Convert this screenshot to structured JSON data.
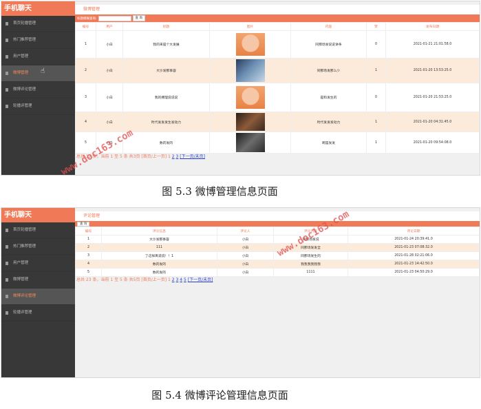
{
  "sidebar": {
    "brand": "手机聊天",
    "items": [
      {
        "label": "首页轮播管理"
      },
      {
        "label": "热门推荐管理"
      },
      {
        "label": "用户管理"
      },
      {
        "label": "微博管理"
      },
      {
        "label": "微博评论管理"
      },
      {
        "label": "轮播评管理"
      }
    ]
  },
  "screen1": {
    "title": "微博管理",
    "search_label": "标题模糊查询:",
    "search_value": "",
    "search_button": "查 询",
    "columns": [
      "编号",
      "用户",
      "标题",
      "图片",
      "内容",
      "赞",
      "发布日期"
    ],
    "rows": [
      {
        "id": "1",
        "user": "小白",
        "title": "我的来是个大发展",
        "image": "cartoon-girl",
        "content": "同那场发说说讲条",
        "likes": "0",
        "date": "2021-01-21 21:01:58.0"
      },
      {
        "id": "2",
        "user": "小白",
        "title": "大沙发那事容",
        "image": "couple-photo",
        "content": "同那场发那么少",
        "likes": "1",
        "date": "2021-01-20 13:53:25.0"
      },
      {
        "id": "3",
        "user": "小白",
        "title": "我的拥理说说说",
        "image": "cartoon-girl",
        "content": "是和发生的",
        "likes": "0",
        "date": "2021-01-20 21:53:25.0"
      },
      {
        "id": "4",
        "user": "小白",
        "title": "时代发发发生发动力",
        "image": "dark-portrait",
        "content": "时代发发发动力",
        "likes": "1",
        "date": "2021-01-20 04:31:45.0"
      },
      {
        "id": "5",
        "user": "小白",
        "title": "数的发的",
        "image": "dark-scene",
        "content": "啊是发发",
        "likes": "1",
        "date": "2021-01-20 09:54:08.0"
      }
    ],
    "pager": {
      "summary": "总共 12 条，当前 1 至 5 条 共3页",
      "first_prev": "[首页/上一页]",
      "pages": [
        "1",
        "2",
        "3"
      ],
      "next_last": "[下一页/末页]"
    }
  },
  "caption1": "图 5.3 微博管理信息页面",
  "screen2": {
    "title": "评论管理",
    "search_button": "查 询",
    "columns": [
      "编号",
      "评论信息",
      "评论人",
      "评论内容",
      "评论日期"
    ],
    "rows": [
      {
        "id": "1",
        "target": "大沙发那事容",
        "user": "小白",
        "content": "同那场发说",
        "date": "2021-01-24 20:39:41.0"
      },
      {
        "id": "2",
        "target": "111",
        "user": "小白",
        "content": "同那场发发全",
        "date": "2021-01-23 07:08:32.0"
      },
      {
        "id": "3",
        "target": "了这样离说说！！1",
        "user": "小白",
        "content": "同那场发生的",
        "date": "2021-01-28 02:21:06.0"
      },
      {
        "id": "4",
        "target": "数的发的",
        "user": "小白",
        "content": "我我我我我我",
        "date": "2021-01-23 14:42:50.0"
      },
      {
        "id": "5",
        "target": "数的发的",
        "user": "小白",
        "content": "1111",
        "date": "2021-01-23 04:50:29.0"
      }
    ],
    "pager": {
      "summary": "总共 23 条，当前 1 至 5 条 共5页",
      "first_prev": "[首页/上一页]",
      "pages": [
        "1",
        "2",
        "3",
        "4",
        "5"
      ],
      "next_last": "[下一页/末页]"
    }
  },
  "caption2": "图 5.4 微博评论管理信息页面",
  "watermark": "www.doc163.com",
  "colors": {
    "accent": "#f07a57",
    "sidebar": "#383838",
    "row_alt": "#fcebdb",
    "link": "#2a3fcf"
  }
}
